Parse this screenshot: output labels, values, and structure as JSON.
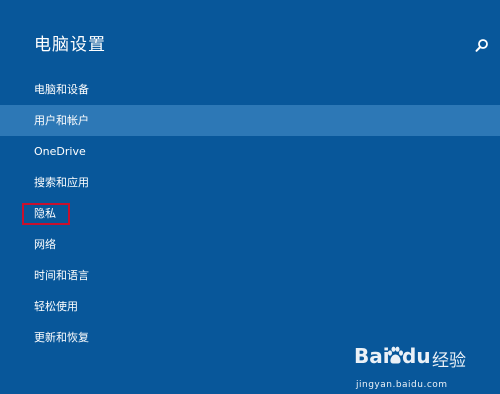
{
  "header": {
    "title": "电脑设置"
  },
  "nav": {
    "items": [
      {
        "label": "电脑和设备"
      },
      {
        "label": "用户和帐户"
      },
      {
        "label": "OneDrive"
      },
      {
        "label": "搜索和应用"
      },
      {
        "label": "隐私"
      },
      {
        "label": "网络"
      },
      {
        "label": "时间和语言"
      },
      {
        "label": "轻松使用"
      },
      {
        "label": "更新和恢复"
      }
    ],
    "selected_label": "用户和帐户",
    "highlighted_label": "隐私"
  },
  "icons": {
    "search": "search-icon",
    "watermark_paw": "paw-icon"
  },
  "colors": {
    "background": "#08579a",
    "selected_row": "#2d78b6",
    "highlight_border": "#c8102e",
    "text": "#ffffff"
  },
  "watermark": {
    "brand_left": "Bai",
    "brand_right": "du",
    "brand_cn": "经验",
    "url": "jingyan.baidu.com"
  }
}
